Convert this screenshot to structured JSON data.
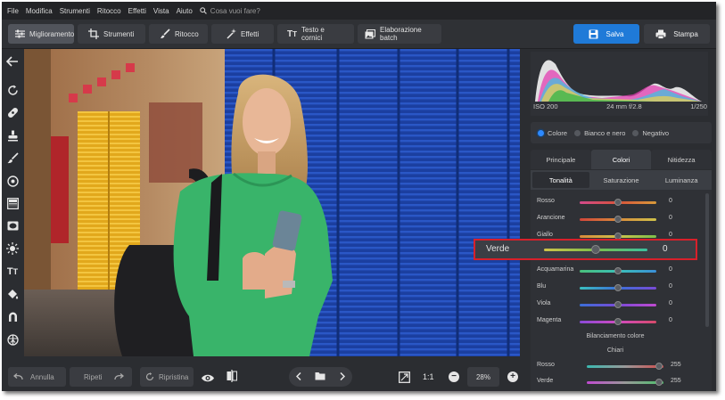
{
  "menu": {
    "items": [
      "File",
      "Modifica",
      "Strumenti",
      "Ritocco",
      "Effetti",
      "Vista",
      "Aiuto"
    ],
    "search_placeholder": "Cosa vuoi fare?"
  },
  "toolbar": {
    "tabs": [
      {
        "label": "Miglioramento",
        "icon": "sliders-icon",
        "active": true
      },
      {
        "label": "Strumenti",
        "icon": "crop-icon",
        "active": false
      },
      {
        "label": "Ritocco",
        "icon": "brush-icon",
        "active": false
      },
      {
        "label": "Effetti",
        "icon": "magic-wand-icon",
        "active": false
      },
      {
        "label": "Testo e cornici",
        "icon": "text-icon",
        "active": false
      }
    ],
    "batch_label": "Elaborazione batch",
    "save_label": "Salva",
    "print_label": "Stampa",
    "accent": "#1f7ad8"
  },
  "histogram": {
    "iso": "ISO 200",
    "lens": "24 mm f/2.8",
    "shutter": "1/250"
  },
  "color_mode": {
    "options": [
      "Colore",
      "Bianco e nero",
      "Negativo"
    ],
    "selected": "Colore"
  },
  "tabs": {
    "items": [
      "Principale",
      "Colori",
      "Nitidezza"
    ],
    "selected": "Colori"
  },
  "subtabs": {
    "items": [
      "Tonalità",
      "Saturazione",
      "Luminanza"
    ],
    "selected": "Tonalità"
  },
  "hue_sliders": [
    {
      "label": "Rosso",
      "value": "0"
    },
    {
      "label": "Arancione",
      "value": "0"
    },
    {
      "label": "Giallo",
      "value": "0"
    },
    {
      "label": "Verde",
      "value": "0"
    },
    {
      "label": "Acquamarina",
      "value": "0"
    },
    {
      "label": "Blu",
      "value": "0"
    },
    {
      "label": "Viola",
      "value": "0"
    },
    {
      "label": "Magenta",
      "value": "0"
    }
  ],
  "balance": {
    "title": "Bilanciamento colore",
    "group": "Chiari",
    "rows": [
      {
        "label": "Rosso",
        "value": "255"
      },
      {
        "label": "Verde",
        "value": "255"
      }
    ]
  },
  "highlight": {
    "label": "Verde",
    "value": "0",
    "color": "#d8202a"
  },
  "bottom": {
    "undo_label": "Annulla",
    "redo_label": "Ripeti",
    "reset_label": "Ripristina",
    "zoom_ratio": "1:1",
    "zoom_percent": "28%"
  }
}
